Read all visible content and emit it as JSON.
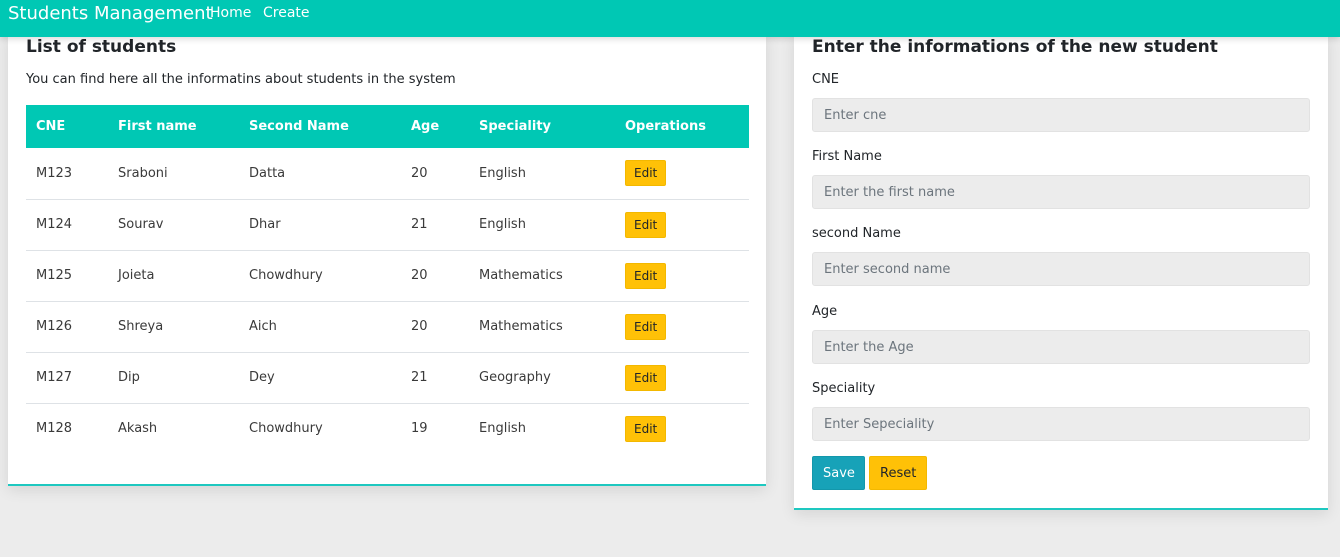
{
  "navbar": {
    "brand": "Students Management",
    "links": [
      "Home",
      "Create"
    ]
  },
  "list_card": {
    "title": "List of students",
    "subtitle": "You can find here all the informatins about students in the system",
    "columns": [
      "CNE",
      "First name",
      "Second Name",
      "Age",
      "Speciality",
      "Operations"
    ],
    "edit_label": "Edit",
    "rows": [
      {
        "cne": "M123",
        "first": "Sraboni",
        "second": "Datta",
        "age": "20",
        "speciality": "English"
      },
      {
        "cne": "M124",
        "first": "Sourav",
        "second": "Dhar",
        "age": "21",
        "speciality": "English"
      },
      {
        "cne": "M125",
        "first": "Joieta",
        "second": "Chowdhury",
        "age": "20",
        "speciality": "Mathematics"
      },
      {
        "cne": "M126",
        "first": "Shreya",
        "second": "Aich",
        "age": "20",
        "speciality": "Mathematics"
      },
      {
        "cne": "M127",
        "first": "Dip",
        "second": "Dey",
        "age": "21",
        "speciality": "Geography"
      },
      {
        "cne": "M128",
        "first": "Akash",
        "second": "Chowdhury",
        "age": "19",
        "speciality": "English"
      }
    ]
  },
  "form_card": {
    "title": "Enter the informations of the new student",
    "fields": [
      {
        "label": "CNE",
        "placeholder": "Enter cne",
        "value": ""
      },
      {
        "label": "First Name",
        "placeholder": "Enter the first name",
        "value": ""
      },
      {
        "label": "second Name",
        "placeholder": "Enter second name",
        "value": ""
      },
      {
        "label": "Age",
        "placeholder": "Enter the Age",
        "value": ""
      },
      {
        "label": "Speciality",
        "placeholder": "Enter Sepeciality",
        "value": ""
      }
    ],
    "save_label": "Save",
    "reset_label": "Reset"
  },
  "colors": {
    "navbar": "#00c8b4",
    "table_header": "#00c8b4",
    "edit_button": "#ffc107",
    "save_button": "#17a2b8",
    "reset_button": "#ffc107",
    "page_background": "#ececec"
  }
}
